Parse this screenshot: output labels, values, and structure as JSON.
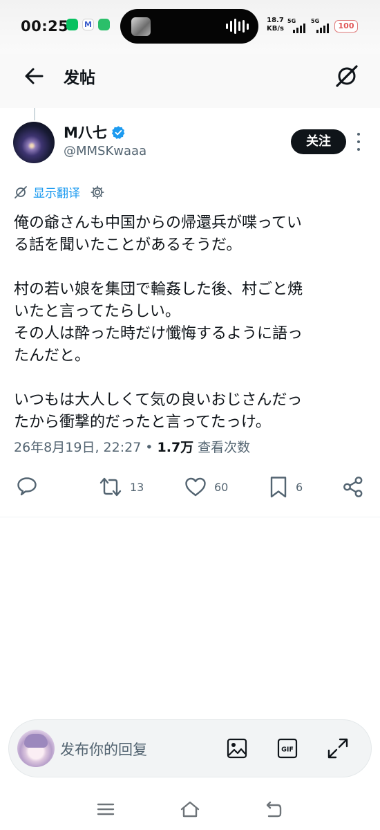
{
  "status_bar": {
    "time": "00:25",
    "app_icons": [
      "wechat-icon",
      "mail-m-icon",
      "chat-app-icon"
    ],
    "net_speed_value": "18.7",
    "net_speed_unit": "KB/s",
    "sim1_tag": "5G",
    "sim2_tag": "5G",
    "battery": "100"
  },
  "header": {
    "title": "发帖",
    "back_icon": "arrow-left-icon",
    "grok_icon": "grok-icon"
  },
  "tweet": {
    "author": {
      "display_name": "M八七",
      "handle": "@MMSKwaaa",
      "verified": true
    },
    "follow_label": "关注",
    "translate_label": "显示翻译",
    "text": "俺の爺さんも中国からの帰還兵が喋ってい\nる話を聞いたことがあるそうだ。\n\n村の若い娘を集団で輪姦した後、村ごと焼\nいたと言ってたらしい。\nその人は酔った時だけ懺悔するように語っ\nたんだと。\n\nいつもは大人しくて気の良いおじさんだっ\nたから衝撃的だったと言ってたっけ。",
    "meta": {
      "timestamp": "26年8月19日, 22:27",
      "separator": "•",
      "views": "1.7万",
      "views_label": "查看次数"
    },
    "actions": {
      "reply_count": "",
      "retweet_count": "13",
      "like_count": "60",
      "bookmark_count": "6"
    }
  },
  "reply_bar": {
    "placeholder": "发布你的回复",
    "gif_label": "GIF",
    "icons": [
      "image-icon",
      "gif-icon",
      "expand-icon"
    ]
  },
  "colors": {
    "accent": "#1d9bf0",
    "text_primary": "#0f1419",
    "text_secondary": "#536471",
    "follow_button": "#0f1419"
  }
}
